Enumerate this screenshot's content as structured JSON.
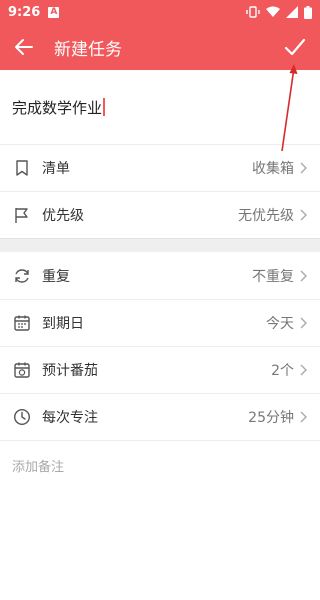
{
  "statusbar": {
    "time": "9:26",
    "notif_badge": "A"
  },
  "header": {
    "title": "新建任务"
  },
  "task": {
    "value": "完成数学作业"
  },
  "settings_group1": [
    {
      "key": "list",
      "icon": "bookmark-icon",
      "label": "清单",
      "value": "收集箱"
    },
    {
      "key": "priority",
      "icon": "flag-icon",
      "label": "优先级",
      "value": "无优先级"
    }
  ],
  "settings_group2": [
    {
      "key": "repeat",
      "icon": "repeat-icon",
      "label": "重复",
      "value": "不重复"
    },
    {
      "key": "due",
      "icon": "calendar-icon",
      "label": "到期日",
      "value": "今天"
    },
    {
      "key": "pomodoro",
      "icon": "tomato-calendar-icon",
      "label": "预计番茄",
      "value": "2个"
    },
    {
      "key": "focus",
      "icon": "clock-icon",
      "label": "每次专注",
      "value": "25分钟"
    }
  ],
  "note": {
    "placeholder": "添加备注"
  },
  "colors": {
    "accent": "#f0585b",
    "annotation_arrow": "#d62b2b"
  }
}
